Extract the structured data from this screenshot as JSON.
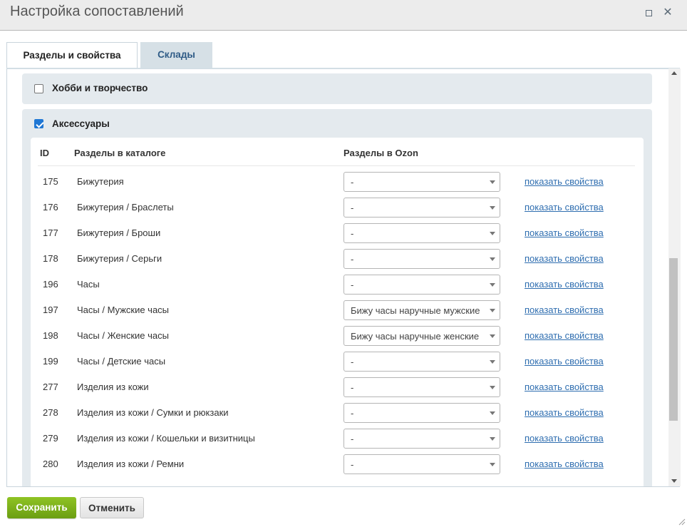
{
  "window": {
    "title": "Настройка сопоставлений"
  },
  "tabs": [
    {
      "label": "Разделы и свойства",
      "active": true
    },
    {
      "label": "Склады",
      "active": false
    }
  ],
  "sections": {
    "hobby": {
      "label": "Хобби и творчество",
      "checked": false
    },
    "accessories": {
      "label": "Аксессуары",
      "checked": true
    }
  },
  "table": {
    "headers": {
      "id": "ID",
      "catalog": "Разделы в каталоге",
      "ozon": "Разделы в Ozon"
    },
    "link_label": "показать свойства",
    "rows": [
      {
        "id": "175",
        "catalog": "Бижутерия",
        "ozon": "-"
      },
      {
        "id": "176",
        "catalog": "Бижутерия / Браслеты",
        "ozon": "-"
      },
      {
        "id": "177",
        "catalog": "Бижутерия / Броши",
        "ozon": "-"
      },
      {
        "id": "178",
        "catalog": "Бижутерия / Серьги",
        "ozon": "-"
      },
      {
        "id": "196",
        "catalog": "Часы",
        "ozon": "-"
      },
      {
        "id": "197",
        "catalog": "Часы / Мужские часы",
        "ozon": "Бижу часы наручные мужские"
      },
      {
        "id": "198",
        "catalog": "Часы / Женские часы",
        "ozon": "Бижу часы наручные женские"
      },
      {
        "id": "199",
        "catalog": "Часы / Детские часы",
        "ozon": "-"
      },
      {
        "id": "277",
        "catalog": "Изделия из кожи",
        "ozon": "-"
      },
      {
        "id": "278",
        "catalog": "Изделия из кожи / Сумки и рюкзаки",
        "ozon": "-"
      },
      {
        "id": "279",
        "catalog": "Изделия из кожи / Кошельки и визитницы",
        "ozon": "-"
      },
      {
        "id": "280",
        "catalog": "Изделия из кожи / Ремни",
        "ozon": "-"
      }
    ]
  },
  "footer": {
    "save_label": "Сохранить",
    "cancel_label": "Отменить"
  },
  "icons": {
    "maximize": "maximize-icon",
    "close": "close-icon",
    "dropdown": "chevron-down-icon"
  },
  "colors": {
    "accent_green": "#7bb01a",
    "link_blue": "#2f6eb0",
    "checkbox_blue": "#1f77d4"
  }
}
